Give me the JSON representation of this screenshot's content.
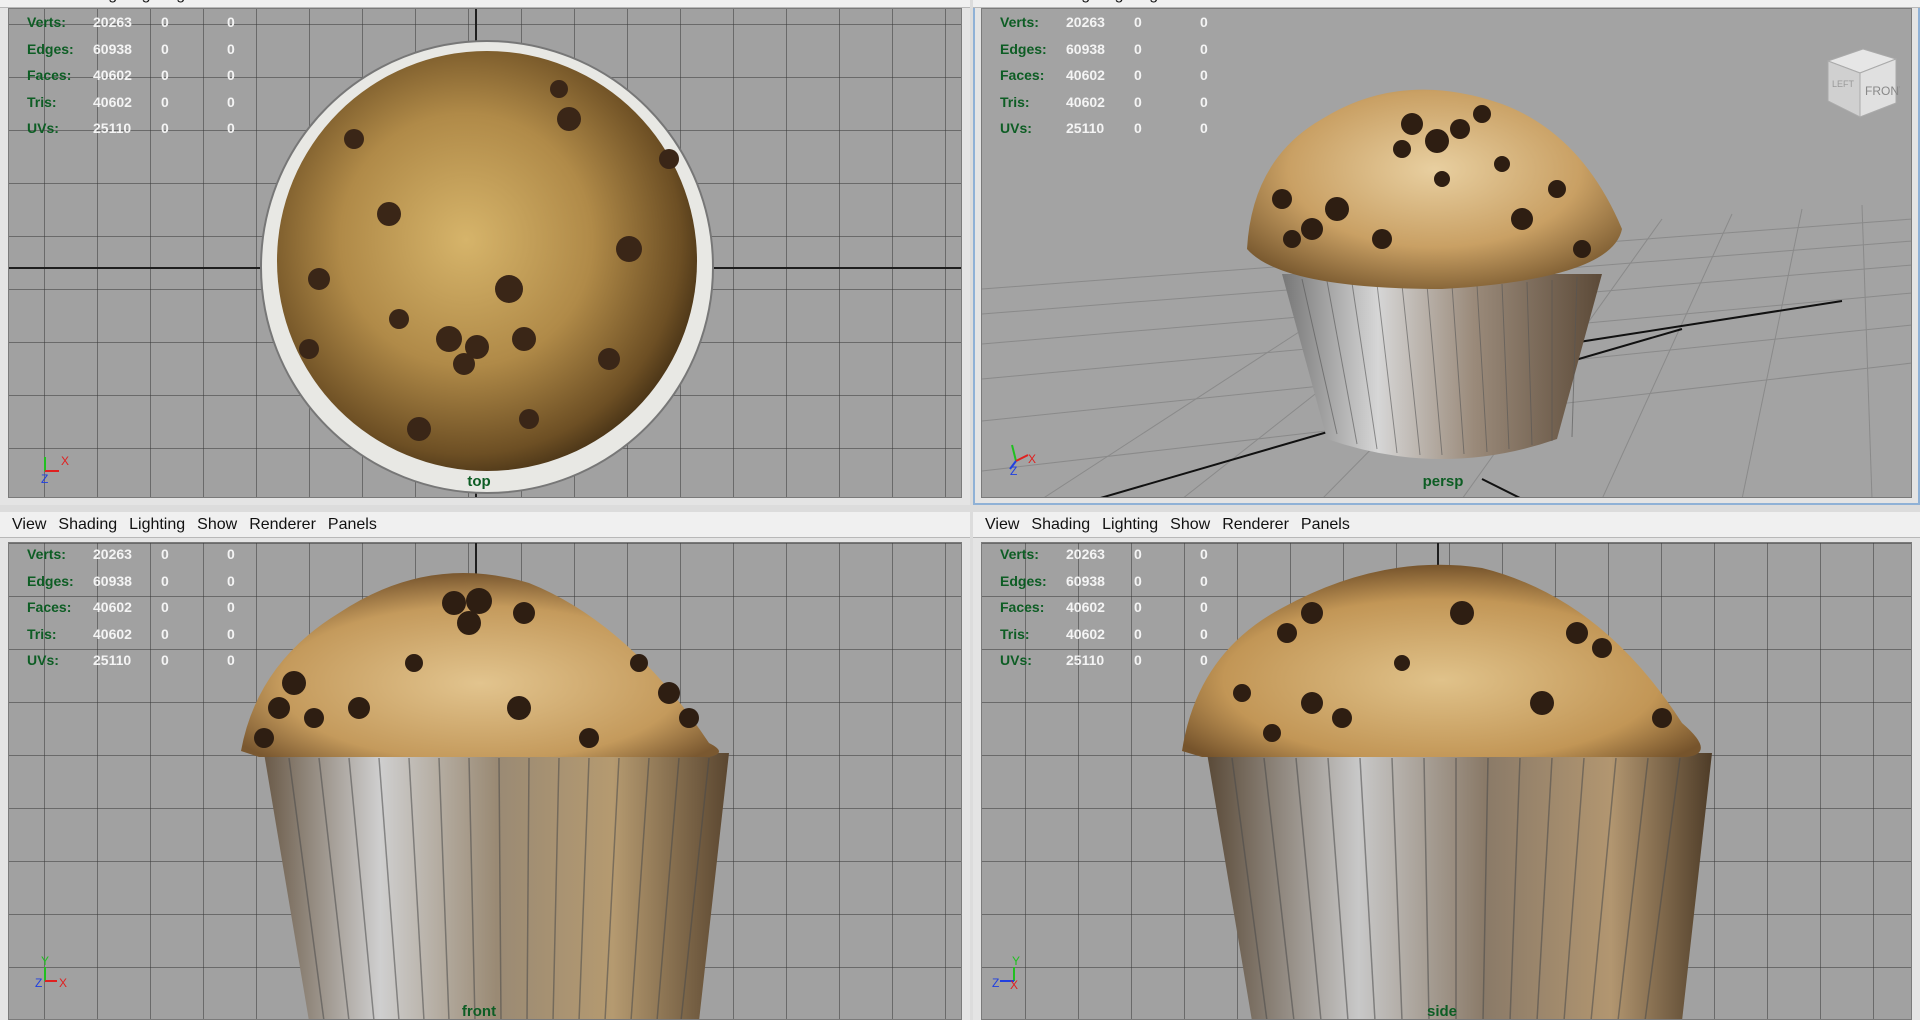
{
  "menu": [
    "View",
    "Shading",
    "Lighting",
    "Show",
    "Renderer",
    "Panels"
  ],
  "stats": {
    "labels": [
      "Verts:",
      "Edges:",
      "Faces:",
      "Tris:",
      "UVs:"
    ],
    "values": [
      "20263",
      "60938",
      "40602",
      "40602",
      "25110"
    ],
    "col2": "0",
    "col3": "0"
  },
  "panels": {
    "top": {
      "camera": "top"
    },
    "persp": {
      "camera": "persp",
      "viewcube": "FRONT",
      "viewcube_side": "LEFT"
    },
    "front": {
      "camera": "front"
    },
    "side": {
      "camera": "side"
    }
  },
  "axes": {
    "x": "X",
    "y": "Y",
    "z": "Z"
  },
  "colors": {
    "hud_label": "#0d5d24",
    "viewport_bg": "#a1a1a1",
    "active_border": "#8fb1d6",
    "axis_x": "#e02020",
    "axis_y": "#20c020",
    "axis_z": "#2040e0"
  },
  "icons": [
    "axis-gizmo-icon",
    "view-cube-icon"
  ]
}
